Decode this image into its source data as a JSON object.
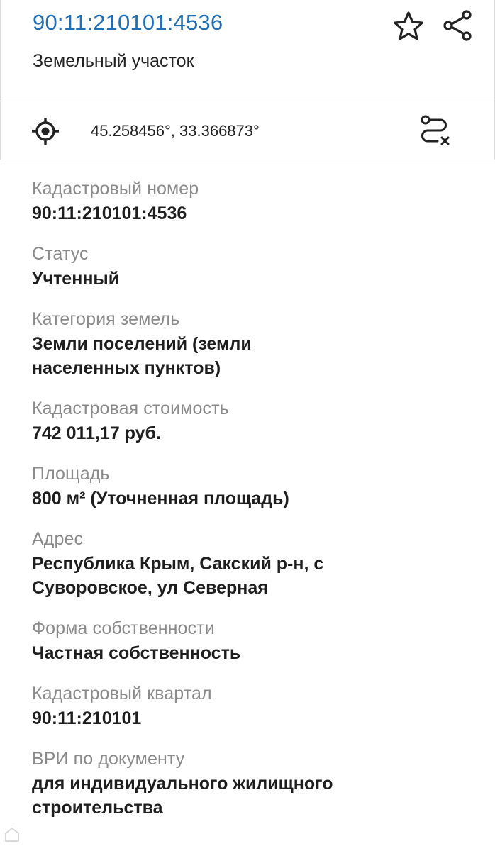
{
  "header": {
    "cadastral_link": "90:11:210101:4536",
    "subtitle": "Земельный участок",
    "favorite_icon": "star-outline",
    "share_icon": "share"
  },
  "coords": {
    "icon": "locate-target",
    "text": "45.258456°, 33.366873°",
    "route_icon": "route-remove"
  },
  "fields": [
    {
      "label": "Кадастровый номер",
      "value": "90:11:210101:4536"
    },
    {
      "label": "Статус",
      "value": "Учтенный"
    },
    {
      "label": "Категория земель",
      "value": "Земли поселений (земли населенных пунктов)"
    },
    {
      "label": "Кадастровая стоимость",
      "value": "742 011,17 руб."
    },
    {
      "label": "Площадь",
      "value": "800 м² (Уточненная площадь)"
    },
    {
      "label": "Адрес",
      "value": "Республика Крым, Сакский р-н, с Суворовское, ул Северная"
    },
    {
      "label": "Форма собственности",
      "value": "Частная собственность"
    },
    {
      "label": "Кадастровый квартал",
      "value": "90:11:210101"
    },
    {
      "label": "ВРИ по документу",
      "value": "для индивидуального жилищного строительства"
    }
  ],
  "colors": {
    "link": "#1f6fb8",
    "label": "#8a8a8a",
    "value": "#1e1e1e",
    "divider": "#d4d4d4"
  }
}
